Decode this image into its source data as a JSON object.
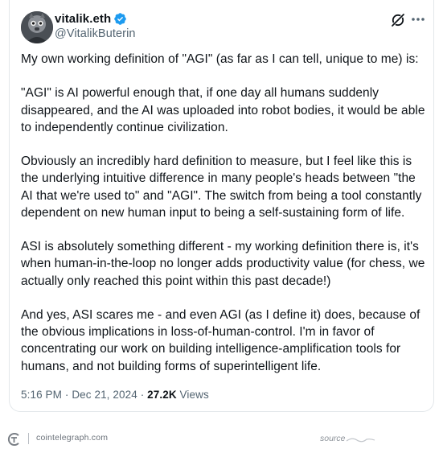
{
  "tweet": {
    "author": {
      "display_name": "vitalik.eth",
      "handle": "@VitalikButerin"
    },
    "paragraphs": [
      "My own working definition of \"AGI\" (as far as I can tell, unique to me) is:",
      "\"AGI\" is AI powerful enough that, if one day all humans suddenly disappeared, and the AI was uploaded into robot bodies, it would be able to independently continue civilization.",
      "Obviously an incredibly hard definition to measure, but I feel like this is the underlying intuitive difference in many people's heads between \"the AI that we're used to\" and \"AGI\". The switch from being a tool constantly dependent on new human input to being a self-sustaining form of life.",
      "ASI is absolutely something different - my working definition there is, it's when human-in-the-loop no longer adds productivity value (for chess, we actually only reached this point within this past decade!)",
      "And yes, ASI scares me - and even AGI (as I define it) does, because of the obvious implications in loss-of-human-control. I'm in favor of concentrating our work on building intelligence-amplification tools for humans, and not building forms of superintelligent life."
    ],
    "time": "5:16 PM",
    "separator": "·",
    "date": "Dec 21, 2024",
    "views_count": "27.2K",
    "views_label": "Views",
    "icons": {
      "verified": "verified-badge-icon",
      "grok": "grok-icon",
      "more": "more-options-icon"
    },
    "colors": {
      "verified_blue": "#1d9bf0",
      "text_primary": "#0f1419",
      "text_secondary": "#536471"
    }
  },
  "footer": {
    "site": "cointelegraph.com",
    "source_label": "source"
  }
}
